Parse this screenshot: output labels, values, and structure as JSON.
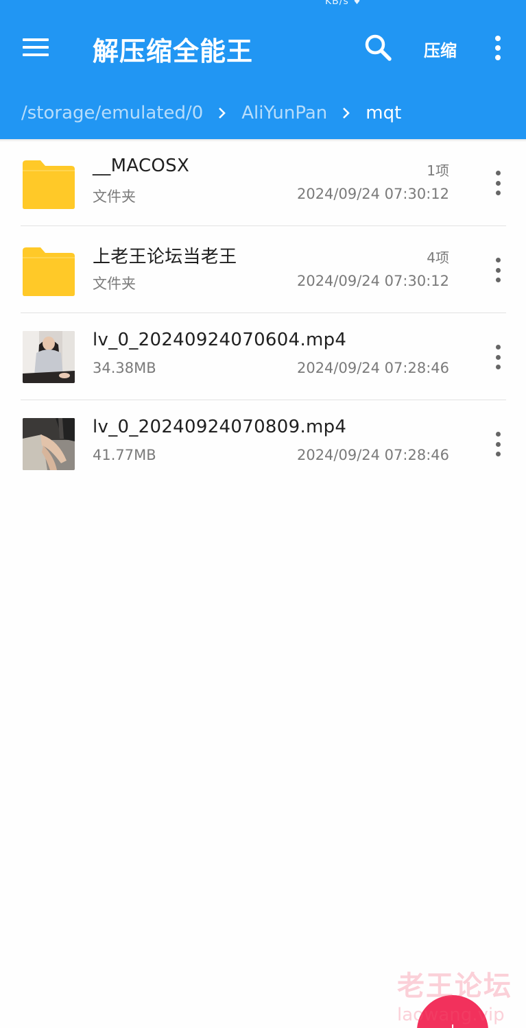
{
  "colors": {
    "appbar": "#2196f3",
    "folder": "#ffc928",
    "fab": "#f2315c",
    "primary_text": "#1f1f1f",
    "secondary_text": "#7a7a7a"
  },
  "status_bar": {
    "fragment": "KB/s ♦"
  },
  "appbar": {
    "menu_icon": "menu-icon",
    "title": "解压缩全能王",
    "search_icon": "search-icon",
    "compress_label": "压缩",
    "overflow_icon": "more-vert-icon"
  },
  "breadcrumb": {
    "items": [
      {
        "label": "/storage/emulated/0"
      },
      {
        "label": "AliYunPan"
      },
      {
        "label": "mqt"
      }
    ],
    "separator_icon": "chevron-right-icon"
  },
  "files": [
    {
      "type": "folder",
      "name": "__MACOSX",
      "kind_label": "文件夹",
      "count": "1项",
      "date": "2024/09/24 07:30:12"
    },
    {
      "type": "folder",
      "name": "上老王论坛当老王",
      "kind_label": "文件夹",
      "count": "4项",
      "date": "2024/09/24 07:30:12"
    },
    {
      "type": "video",
      "name": "lv_0_20240924070604.mp4",
      "size": "34.38MB",
      "date": "2024/09/24 07:28:46"
    },
    {
      "type": "video",
      "name": "lv_0_20240924070809.mp4",
      "size": "41.77MB",
      "date": "2024/09/24 07:28:46"
    }
  ],
  "fab": {
    "icon": "add-icon"
  },
  "watermark": {
    "cn": "老王论坛",
    "en": "laowang.vip"
  }
}
